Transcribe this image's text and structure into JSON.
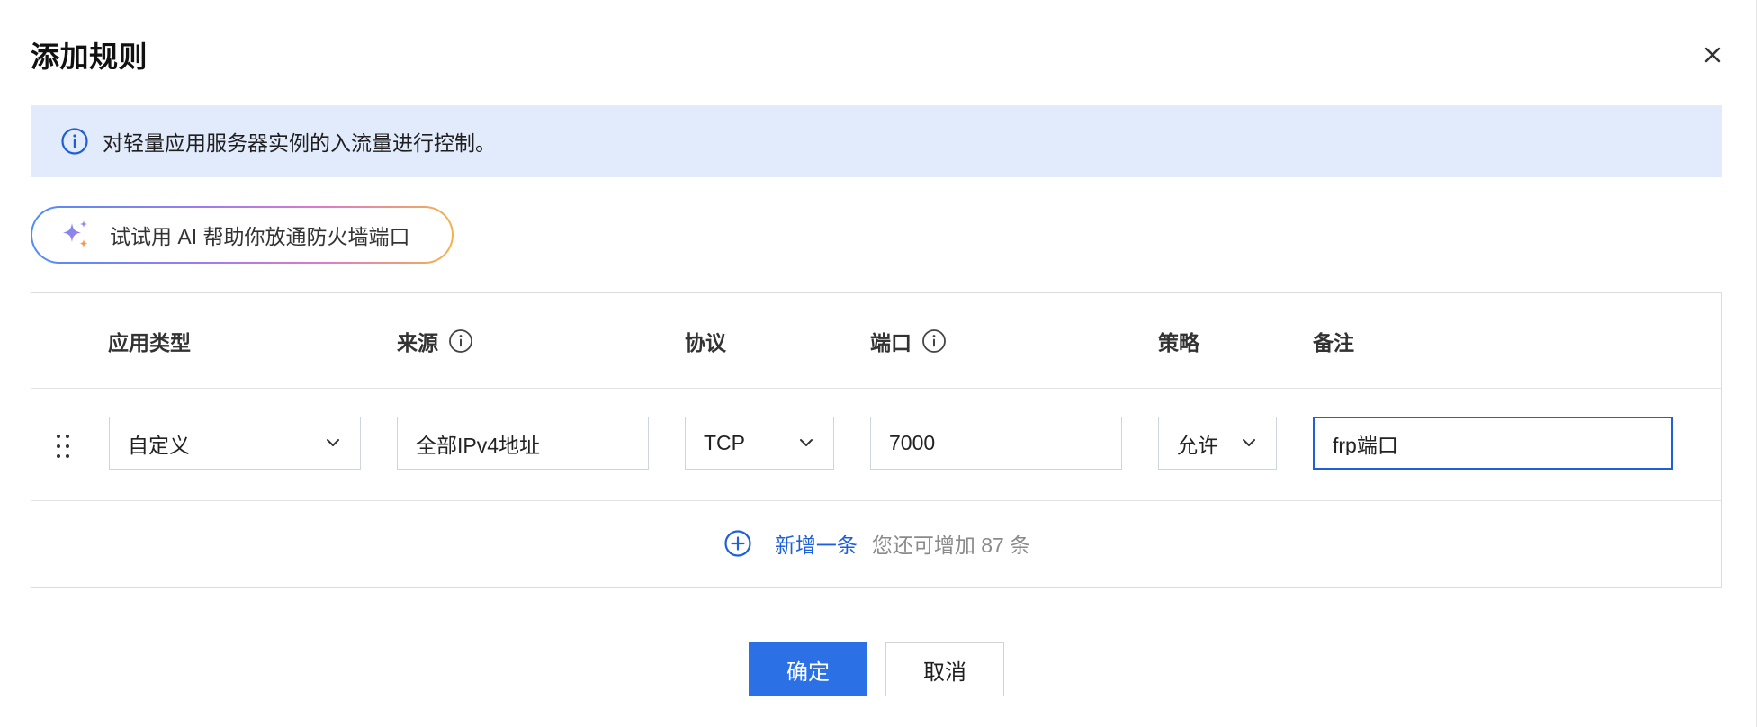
{
  "dialog": {
    "title": "添加规则"
  },
  "info": {
    "message": "对轻量应用服务器实例的入流量进行控制。"
  },
  "ai_assist": {
    "label": "试试用 AI 帮助你放通防火墙端口"
  },
  "table": {
    "headers": {
      "app_type": "应用类型",
      "source": "来源",
      "protocol": "协议",
      "port": "端口",
      "policy": "策略",
      "remark": "备注"
    },
    "row": {
      "app_type": "自定义",
      "source": "全部IPv4地址",
      "protocol": "TCP",
      "port": "7000",
      "policy": "允许",
      "remark": "frp端口"
    }
  },
  "add_row": {
    "label": "新增一条",
    "remaining": "您还可增加 87 条"
  },
  "footer": {
    "ok": "确定",
    "cancel": "取消"
  },
  "colors": {
    "accent": "#2b70e4",
    "banner_bg": "#e2ebfc",
    "link": "#1e60d9"
  },
  "icons": {
    "close": "close-icon",
    "info": "info-circle-icon",
    "sparkle": "sparkle-icon",
    "chevron": "chevron-down-icon",
    "drag": "drag-handle-icon",
    "add": "plus-circle-icon"
  }
}
